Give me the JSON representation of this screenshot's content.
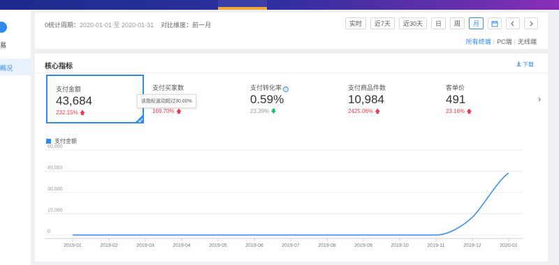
{
  "toolbar": {
    "period_label": "0统计周期：",
    "period_dates": "2020-01-01 至 2020-01-31",
    "compare_label": "对比维度：前一月",
    "buttons": [
      "实时",
      "近7天",
      "近30天",
      "日",
      "周",
      "月"
    ],
    "active_button": "月",
    "terminals": [
      "所有终端",
      "PC端",
      "无线端"
    ],
    "active_terminal": "所有终端"
  },
  "sidebar": {
    "item1": "易",
    "item2": "概况"
  },
  "main": {
    "title": "核心指标",
    "download": "下载",
    "tooltip": "该指标波动超过30.00%",
    "cards": [
      {
        "label": "支付金额",
        "value": "43,684",
        "change": "232.15%",
        "direction": "up",
        "selected": true
      },
      {
        "label": "支付买家数",
        "value": "",
        "change": "169.70%",
        "direction": "up",
        "selected": false
      },
      {
        "label": "支付转化率",
        "value": "0.59%",
        "change": "23.39%",
        "direction": "down",
        "selected": false
      },
      {
        "label": "支付商品件数",
        "value": "10,984",
        "change": "2425.06%",
        "direction": "up",
        "selected": false
      },
      {
        "label": "客单价",
        "value": "491",
        "change": "23.16%",
        "direction": "up",
        "selected": false
      }
    ]
  },
  "chart_data": {
    "type": "line",
    "legend": "支付金额",
    "color": "#2d8cf0",
    "x": [
      "2019-01",
      "2019-02",
      "2019-03",
      "2019-04",
      "2019-05",
      "2019-06",
      "2019-07",
      "2019-08",
      "2019-09",
      "2019-10",
      "2019-11",
      "2019-12",
      "2020-01"
    ],
    "series": [
      {
        "name": "支付金额",
        "values": [
          0,
          0,
          0,
          0,
          0,
          0,
          0,
          0,
          0,
          0,
          0,
          12500,
          43684
        ]
      }
    ],
    "y_ticks": [
      "0",
      "15,000",
      "30,000",
      "45,000",
      "60,000"
    ],
    "ylim": [
      0,
      60000
    ],
    "grid": true,
    "legend_position": "top-left"
  }
}
